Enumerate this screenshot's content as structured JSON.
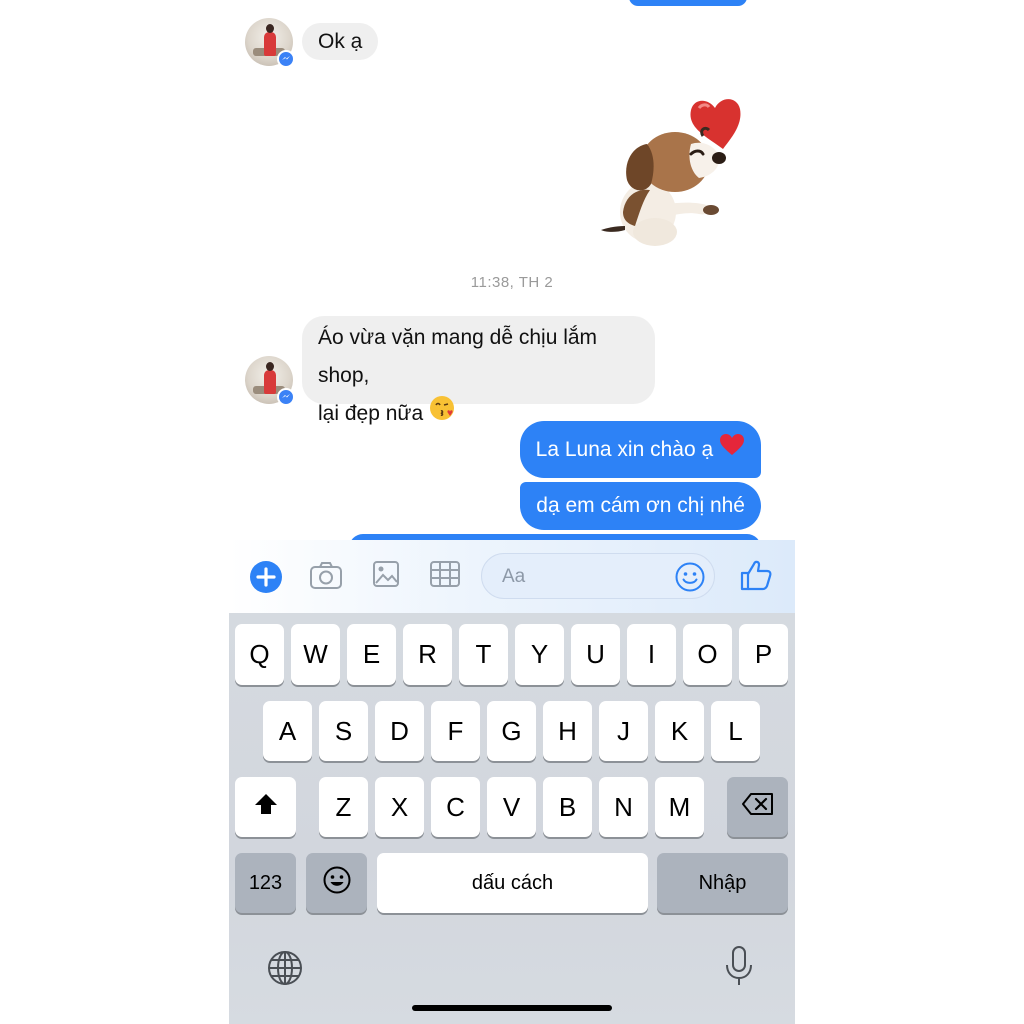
{
  "messages": {
    "incoming_1": "Ok ạ",
    "timestamp": "11:38, TH 2",
    "incoming_2_line1": "Áo vừa vặn mang dễ chịu lắm shop,",
    "incoming_2_line2": "lại đẹp nữa",
    "outgoing_1": "La Luna xin chào ạ",
    "outgoing_2": "dạ em cám ơn chị nhé"
  },
  "composer": {
    "placeholder": "Aa",
    "icons": [
      "plus-icon",
      "camera-icon",
      "image-icon",
      "grid-icon",
      "emoji-icon",
      "thumbs-up-icon"
    ],
    "accent": "#2d82f6"
  },
  "keyboard": {
    "row1": [
      "Q",
      "W",
      "E",
      "R",
      "T",
      "Y",
      "U",
      "I",
      "O",
      "P"
    ],
    "row2": [
      "A",
      "S",
      "D",
      "F",
      "G",
      "H",
      "J",
      "K",
      "L"
    ],
    "row3": [
      "Z",
      "X",
      "C",
      "V",
      "B",
      "N",
      "M"
    ],
    "numbers_label": "123",
    "space_label": "dấu cách",
    "return_label": "Nhập",
    "icons": [
      "shift-icon",
      "backspace-icon",
      "emoji-key-icon",
      "globe-icon",
      "microphone-icon"
    ]
  },
  "colors": {
    "outgoing_bubble": "#2d82f6",
    "incoming_bubble": "#efefef",
    "keyboard_bg": "#d2d6dd"
  }
}
